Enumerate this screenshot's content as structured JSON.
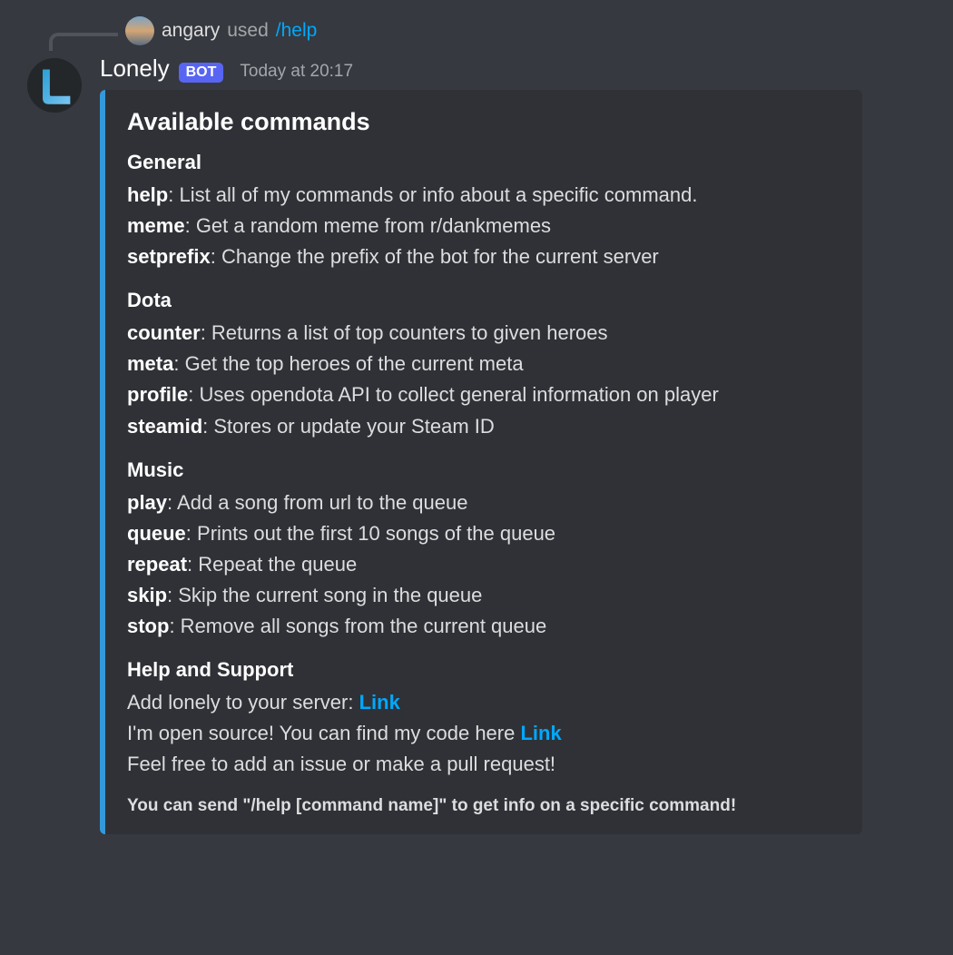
{
  "reply": {
    "username": "angary",
    "action": "used",
    "command": "/help"
  },
  "message": {
    "bot_name": "Lonely",
    "badge": "BOT",
    "timestamp": "Today at 20:17"
  },
  "embed": {
    "title": "Available commands",
    "sections": [
      {
        "title": "General",
        "commands": [
          {
            "name": "help",
            "desc": ": List all of my commands or info about a specific command."
          },
          {
            "name": "meme",
            "desc": ": Get a random meme from r/dankmemes"
          },
          {
            "name": "setprefix",
            "desc": ": Change the prefix of the bot for the current server"
          }
        ]
      },
      {
        "title": "Dota",
        "commands": [
          {
            "name": "counter",
            "desc": ": Returns a list of top counters to given heroes"
          },
          {
            "name": "meta",
            "desc": ": Get the top heroes of the current meta"
          },
          {
            "name": "profile",
            "desc": ": Uses opendota API to collect general information on player"
          },
          {
            "name": "steamid",
            "desc": ": Stores or update your Steam ID"
          }
        ]
      },
      {
        "title": "Music",
        "commands": [
          {
            "name": "play",
            "desc": ": Add a song from url to the queue"
          },
          {
            "name": "queue",
            "desc": ": Prints out the first 10 songs of the queue"
          },
          {
            "name": "repeat",
            "desc": ": Repeat the queue"
          },
          {
            "name": "skip",
            "desc": ": Skip the current song in the queue"
          },
          {
            "name": "stop",
            "desc": ": Remove all songs from the current queue"
          }
        ]
      }
    ],
    "support": {
      "title": "Help and Support",
      "line1_pre": "Add lonely to your server: ",
      "line1_link": "Link",
      "line2_pre": "I'm open source! You can find my code here ",
      "line2_link": "Link",
      "line3": "Feel free to add an issue or make a pull request!"
    },
    "footer": "You can send \"/help [command name]\" to get info on a specific command!"
  }
}
